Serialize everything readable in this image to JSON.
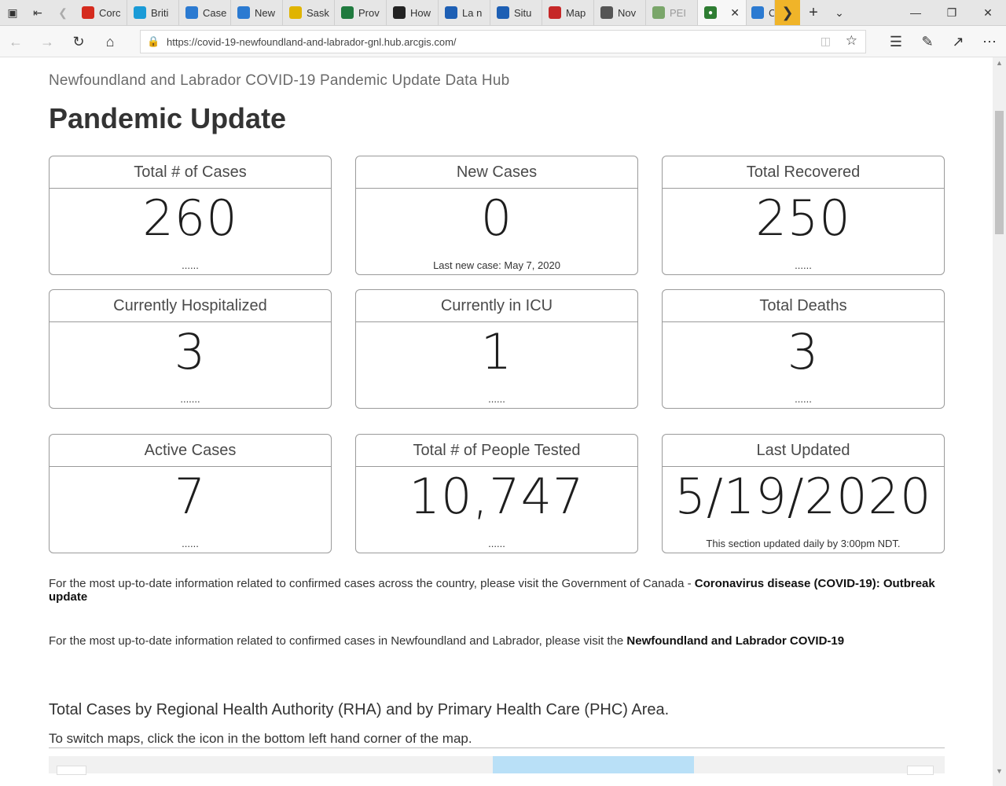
{
  "browser": {
    "tabs": [
      {
        "label": "Corc",
        "icon": "canada-flag-icon",
        "color": "#d52b1e"
      },
      {
        "label": "Briti",
        "icon": "bc-gov-icon",
        "color": "#1a9bd7"
      },
      {
        "label": "Case",
        "icon": "arcgis-icon",
        "color": "#2b7ad1"
      },
      {
        "label": "New",
        "icon": "arcgis-icon",
        "color": "#2b7ad1"
      },
      {
        "label": "Sask",
        "icon": "sask-icon",
        "color": "#e0b400"
      },
      {
        "label": "Prov",
        "icon": "manitoba-icon",
        "color": "#1f7a3e"
      },
      {
        "label": "How",
        "icon": "ontario-icon",
        "color": "#222222"
      },
      {
        "label": "La n",
        "icon": "quebec-icon",
        "color": "#1d5fb4"
      },
      {
        "label": "Situ",
        "icon": "quebec-icon",
        "color": "#1d5fb4"
      },
      {
        "label": "Map",
        "icon": "nb-icon",
        "color": "#c62828"
      },
      {
        "label": "Nov",
        "icon": "ns-icon",
        "color": "#555555"
      },
      {
        "label": "PEI",
        "icon": "pei-icon",
        "color": "#7aa66a"
      }
    ],
    "active_tab_icon": "globe-icon",
    "next_tab_label": "C",
    "url": "https://covid-19-newfoundland-and-labrador-gnl.hub.arcgis.com/"
  },
  "page": {
    "hub_title": "Newfoundland and Labrador COVID-19 Pandemic Update Data Hub",
    "title": "Pandemic Update",
    "cards": [
      {
        "header": "Total # of Cases",
        "value": "260",
        "footer": "......"
      },
      {
        "header": "New Cases",
        "value": "0",
        "footer": "Last new case: May 7, 2020"
      },
      {
        "header": "Total Recovered",
        "value": "250",
        "footer": "......"
      },
      {
        "header": "Currently Hospitalized",
        "value": "3",
        "footer": "......."
      },
      {
        "header": "Currently in ICU",
        "value": "1",
        "footer": "......"
      },
      {
        "header": "Total Deaths",
        "value": "3",
        "footer": "......"
      },
      {
        "header": "Active Cases",
        "value": "7",
        "footer": "......"
      },
      {
        "header": "Total # of People Tested",
        "value": "10,747",
        "footer": "......"
      },
      {
        "header": "Last Updated",
        "value": "5/19/2020",
        "footer": "This section updated daily by 3:00pm NDT."
      }
    ],
    "info1_text": "For the most up-to-date information related to confirmed cases across the country, please visit the Government of Canada - ",
    "info1_link": "Coronavirus disease (COVID-19): Outbreak update",
    "info2_text": "For the most up-to-date information related to confirmed cases in Newfoundland and Labrador, please visit the ",
    "info2_link": "Newfoundland and Labrador COVID-19",
    "section_title": "Total Cases by Regional Health Authority (RHA) and by Primary Health Care (PHC) Area.",
    "section_sub": "To switch maps, click the icon in the bottom left hand corner of the map."
  }
}
